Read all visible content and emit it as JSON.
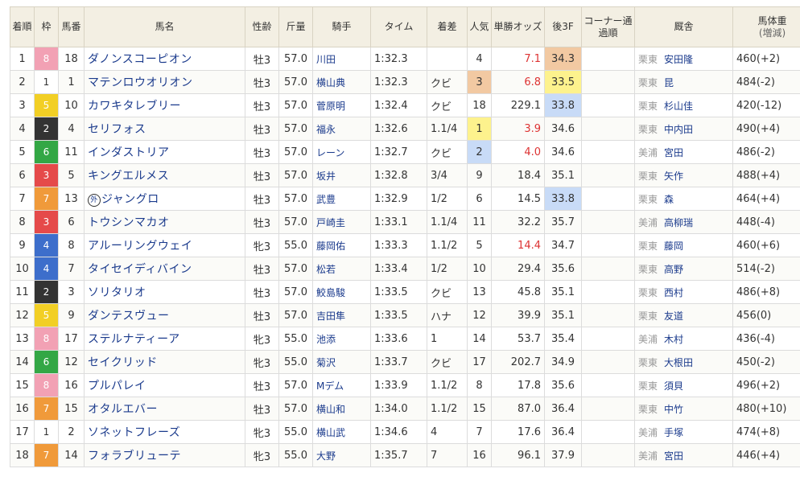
{
  "headers": {
    "rank": "着順",
    "waku": "枠",
    "num": "馬番",
    "horse": "馬名",
    "sexage": "性齢",
    "weight": "斤量",
    "jockey": "騎手",
    "time": "タイム",
    "margin": "着差",
    "pop": "人気",
    "odds": "単勝オッズ",
    "last3f": "後3F",
    "corner": "コーナー通過順",
    "trainer": "厩舎",
    "body": "馬体重",
    "body_sub": "(増減)"
  },
  "waku_colors": {
    "1": "#ffffff",
    "2": "#333333",
    "3": "#e54a4a",
    "4": "#3d6ecb",
    "5": "#f2cf25",
    "6": "#33a745",
    "7": "#f09a3a",
    "8": "#f2a1b4"
  },
  "rows": [
    {
      "rank": "1",
      "waku": "8",
      "num": "18",
      "mark": "",
      "horse": "ダノンスコーピオン",
      "sexage": "牡3",
      "weight": "57.0",
      "jockey": "川田",
      "time": "1:32.3",
      "margin": "",
      "pop": "4",
      "odds": "7.1",
      "last3f": "34.3",
      "corner": "",
      "aff": "栗東",
      "trainer": "安田隆",
      "body": "460(+2)"
    },
    {
      "rank": "2",
      "waku": "1",
      "num": "1",
      "mark": "",
      "horse": "マテンロウオリオン",
      "sexage": "牡3",
      "weight": "57.0",
      "jockey": "横山典",
      "time": "1:32.3",
      "margin": "クビ",
      "pop": "3",
      "odds": "6.8",
      "last3f": "33.5",
      "corner": "",
      "aff": "栗東",
      "trainer": "昆",
      "body": "484(-2)"
    },
    {
      "rank": "3",
      "waku": "5",
      "num": "10",
      "mark": "",
      "horse": "カワキタレブリー",
      "sexage": "牡3",
      "weight": "57.0",
      "jockey": "菅原明",
      "time": "1:32.4",
      "margin": "クビ",
      "pop": "18",
      "odds": "229.1",
      "last3f": "33.8",
      "corner": "",
      "aff": "栗東",
      "trainer": "杉山佳",
      "body": "420(-12)"
    },
    {
      "rank": "4",
      "waku": "2",
      "num": "4",
      "mark": "",
      "horse": "セリフォス",
      "sexage": "牡3",
      "weight": "57.0",
      "jockey": "福永",
      "time": "1:32.6",
      "margin": "1.1/4",
      "pop": "1",
      "odds": "3.9",
      "last3f": "34.6",
      "corner": "",
      "aff": "栗東",
      "trainer": "中内田",
      "body": "490(+4)"
    },
    {
      "rank": "5",
      "waku": "6",
      "num": "11",
      "mark": "",
      "horse": "インダストリア",
      "sexage": "牡3",
      "weight": "57.0",
      "jockey": "レーン",
      "time": "1:32.7",
      "margin": "クビ",
      "pop": "2",
      "odds": "4.0",
      "last3f": "34.6",
      "corner": "",
      "aff": "美浦",
      "trainer": "宮田",
      "body": "486(-2)"
    },
    {
      "rank": "6",
      "waku": "3",
      "num": "5",
      "mark": "",
      "horse": "キングエルメス",
      "sexage": "牡3",
      "weight": "57.0",
      "jockey": "坂井",
      "time": "1:32.8",
      "margin": "3/4",
      "pop": "9",
      "odds": "18.4",
      "last3f": "35.1",
      "corner": "",
      "aff": "栗東",
      "trainer": "矢作",
      "body": "488(+4)"
    },
    {
      "rank": "7",
      "waku": "7",
      "num": "13",
      "mark": "外",
      "horse": "ジャングロ",
      "sexage": "牡3",
      "weight": "57.0",
      "jockey": "武豊",
      "time": "1:32.9",
      "margin": "1/2",
      "pop": "6",
      "odds": "14.5",
      "last3f": "33.8",
      "corner": "",
      "aff": "栗東",
      "trainer": "森",
      "body": "464(+4)"
    },
    {
      "rank": "8",
      "waku": "3",
      "num": "6",
      "mark": "",
      "horse": "トウシンマカオ",
      "sexage": "牡3",
      "weight": "57.0",
      "jockey": "戸崎圭",
      "time": "1:33.1",
      "margin": "1.1/4",
      "pop": "11",
      "odds": "32.2",
      "last3f": "35.7",
      "corner": "",
      "aff": "美浦",
      "trainer": "高柳瑞",
      "body": "448(-4)"
    },
    {
      "rank": "9",
      "waku": "4",
      "num": "8",
      "mark": "",
      "horse": "アルーリングウェイ",
      "sexage": "牝3",
      "weight": "55.0",
      "jockey": "藤岡佑",
      "time": "1:33.3",
      "margin": "1.1/2",
      "pop": "5",
      "odds": "14.4",
      "last3f": "34.7",
      "corner": "",
      "aff": "栗東",
      "trainer": "藤岡",
      "body": "460(+6)"
    },
    {
      "rank": "10",
      "waku": "4",
      "num": "7",
      "mark": "",
      "horse": "タイセイディバイン",
      "sexage": "牡3",
      "weight": "57.0",
      "jockey": "松若",
      "time": "1:33.4",
      "margin": "1/2",
      "pop": "10",
      "odds": "29.4",
      "last3f": "35.6",
      "corner": "",
      "aff": "栗東",
      "trainer": "高野",
      "body": "514(-2)"
    },
    {
      "rank": "11",
      "waku": "2",
      "num": "3",
      "mark": "",
      "horse": "ソリタリオ",
      "sexage": "牡3",
      "weight": "57.0",
      "jockey": "鮫島駿",
      "time": "1:33.5",
      "margin": "クビ",
      "pop": "13",
      "odds": "45.8",
      "last3f": "35.1",
      "corner": "",
      "aff": "栗東",
      "trainer": "西村",
      "body": "486(+8)"
    },
    {
      "rank": "12",
      "waku": "5",
      "num": "9",
      "mark": "",
      "horse": "ダンテスヴュー",
      "sexage": "牡3",
      "weight": "57.0",
      "jockey": "吉田隼",
      "time": "1:33.5",
      "margin": "ハナ",
      "pop": "12",
      "odds": "39.9",
      "last3f": "35.1",
      "corner": "",
      "aff": "栗東",
      "trainer": "友道",
      "body": "456(0)"
    },
    {
      "rank": "13",
      "waku": "8",
      "num": "17",
      "mark": "",
      "horse": "ステルナティーア",
      "sexage": "牝3",
      "weight": "55.0",
      "jockey": "池添",
      "time": "1:33.6",
      "margin": "1",
      "pop": "14",
      "odds": "53.7",
      "last3f": "35.4",
      "corner": "",
      "aff": "美浦",
      "trainer": "木村",
      "body": "436(-4)"
    },
    {
      "rank": "14",
      "waku": "6",
      "num": "12",
      "mark": "",
      "horse": "セイクリッド",
      "sexage": "牝3",
      "weight": "55.0",
      "jockey": "菊沢",
      "time": "1:33.7",
      "margin": "クビ",
      "pop": "17",
      "odds": "202.7",
      "last3f": "34.9",
      "corner": "",
      "aff": "栗東",
      "trainer": "大根田",
      "body": "450(-2)"
    },
    {
      "rank": "15",
      "waku": "8",
      "num": "16",
      "mark": "",
      "horse": "プルパレイ",
      "sexage": "牡3",
      "weight": "57.0",
      "jockey": "Mデム",
      "time": "1:33.9",
      "margin": "1.1/2",
      "pop": "8",
      "odds": "17.8",
      "last3f": "35.6",
      "corner": "",
      "aff": "栗東",
      "trainer": "須貝",
      "body": "496(+2)"
    },
    {
      "rank": "16",
      "waku": "7",
      "num": "15",
      "mark": "",
      "horse": "オタルエバー",
      "sexage": "牡3",
      "weight": "57.0",
      "jockey": "横山和",
      "time": "1:34.0",
      "margin": "1.1/2",
      "pop": "15",
      "odds": "87.0",
      "last3f": "36.4",
      "corner": "",
      "aff": "栗東",
      "trainer": "中竹",
      "body": "480(+10)"
    },
    {
      "rank": "17",
      "waku": "1",
      "num": "2",
      "mark": "",
      "horse": "ソネットフレーズ",
      "sexage": "牝3",
      "weight": "55.0",
      "jockey": "横山武",
      "time": "1:34.6",
      "margin": "4",
      "pop": "7",
      "odds": "17.6",
      "last3f": "36.4",
      "corner": "",
      "aff": "美浦",
      "trainer": "手塚",
      "body": "474(+8)"
    },
    {
      "rank": "18",
      "waku": "7",
      "num": "14",
      "mark": "",
      "horse": "フォラブリューテ",
      "sexage": "牝3",
      "weight": "55.0",
      "jockey": "大野",
      "time": "1:35.7",
      "margin": "7",
      "pop": "16",
      "odds": "96.1",
      "last3f": "37.9",
      "corner": "",
      "aff": "美浦",
      "trainer": "宮田",
      "body": "446(+4)"
    }
  ]
}
